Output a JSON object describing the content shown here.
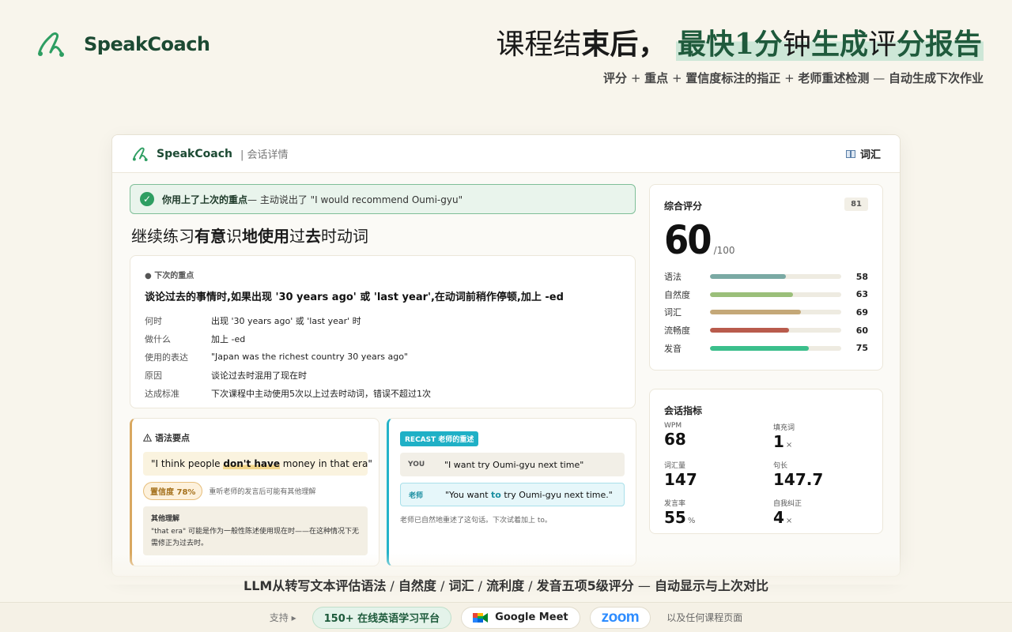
{
  "brand": {
    "name": "SpeakCoach"
  },
  "headline": {
    "part1": "课程",
    "part2": "结",
    "part3": "束后，",
    "part4": "最快",
    "part5": "1分",
    "part6": "钟",
    "part7": "生成",
    "part8": "评",
    "part9": "分",
    "part10": "报告",
    "sub_a": "评分",
    "sub_b": " + ",
    "sub_c": "重点",
    "sub_d": " + ",
    "sub_e": "置信度标注的指正",
    "sub_f": " + ",
    "sub_g": "老师重述检测",
    "sub_h": " — ",
    "sub_i": "自动生成下次作业"
  },
  "app": {
    "brand": "SpeakCoach",
    "section": "| 会话详情",
    "vocab_icon": "book-icon",
    "vocab_label": "词汇"
  },
  "banner": {
    "strong": "你用上了上次的重点",
    "rest": " — 主动说出了 \"I would recommend Oumi-gyu\""
  },
  "section_title": {
    "a": "继续练习",
    "b": "有意",
    "c": "识",
    "d": "地使用",
    "e": "过",
    "f": "去",
    "g": "时动词"
  },
  "focus": {
    "label": "● 下次的重点",
    "text": "谈论过去的事情时,如果出现 '30 years ago' 或 'last year',在动词前稍作停顿,加上 -ed",
    "rows": [
      {
        "k": "何时",
        "v": "出现 '30 years ago' 或 'last year' 时"
      },
      {
        "k": "做什么",
        "v": "加上 -ed"
      },
      {
        "k": "使用的表达",
        "v": "\"Japan was the richest country 30 years ago\""
      },
      {
        "k": "原因",
        "v": "谈论过去时混用了现在时"
      },
      {
        "k": "达成标准",
        "v": "下次课程中主动使用5次以上过去时动词，错误不超过1次"
      }
    ]
  },
  "grammar": {
    "title": "语法要点",
    "quote_pre": "\"I think people ",
    "quote_mark": "don't have",
    "quote_post": " money in that era\"",
    "confidence": "置信度 78%",
    "confidence_note": "重听老师的发言后可能有其他理解",
    "alt_title": "其他理解",
    "alt_text": "\"that era\" 可能是作为一般性陈述使用现在时——在这种情况下无需修正为过去时。"
  },
  "recast": {
    "tag": "RECAST 老师的重述",
    "you_label": "YOU",
    "you_text": "\"I want try Oumi-gyu next time\"",
    "teacher_label": "老师",
    "teacher_pre": "\"You want ",
    "teacher_mark": "to",
    "teacher_post": " try Oumi-gyu next time.\"",
    "note": "老师已自然地重述了这句话。下次试着加上 to。"
  },
  "score": {
    "title": "综合评分",
    "previous": "81",
    "value": "60",
    "max": "/100",
    "bars": [
      {
        "label": "语法",
        "value": 58,
        "color": "#7aa9a4"
      },
      {
        "label": "自然度",
        "value": 63,
        "color": "#9bbf7a"
      },
      {
        "label": "词汇",
        "value": 69,
        "color": "#c4a878"
      },
      {
        "label": "流畅度",
        "value": 60,
        "color": "#b95b4c"
      },
      {
        "label": "发音",
        "value": 75,
        "color": "#3bbf8c"
      }
    ]
  },
  "metrics": {
    "title": "会话指标",
    "items": [
      {
        "label": "WPM",
        "value": "68",
        "unit": ""
      },
      {
        "label": "填充词",
        "value": "1",
        "unit": "×"
      },
      {
        "label": "词汇量",
        "value": "147",
        "unit": ""
      },
      {
        "label": "句长",
        "value": "147.7",
        "unit": ""
      },
      {
        "label": "发言率",
        "value": "55",
        "unit": "%"
      },
      {
        "label": "自我纠正",
        "value": "4",
        "unit": "×"
      }
    ]
  },
  "bottom": {
    "a": "LLM从转写文本评估语法",
    "b": " / ",
    "c": "自然度",
    "d": " / ",
    "e": "词汇",
    "f": " / ",
    "g": "流利度",
    "h": " / ",
    "i": "发音五项5级评分",
    "j": " — ",
    "k": "自动显示与上次对比"
  },
  "support": {
    "label": "支持 ▸",
    "platforms": "150+ 在线英语学习平台",
    "google_meet": "Google Meet",
    "zoom": "zoom",
    "tail": "以及任何课程页面"
  }
}
